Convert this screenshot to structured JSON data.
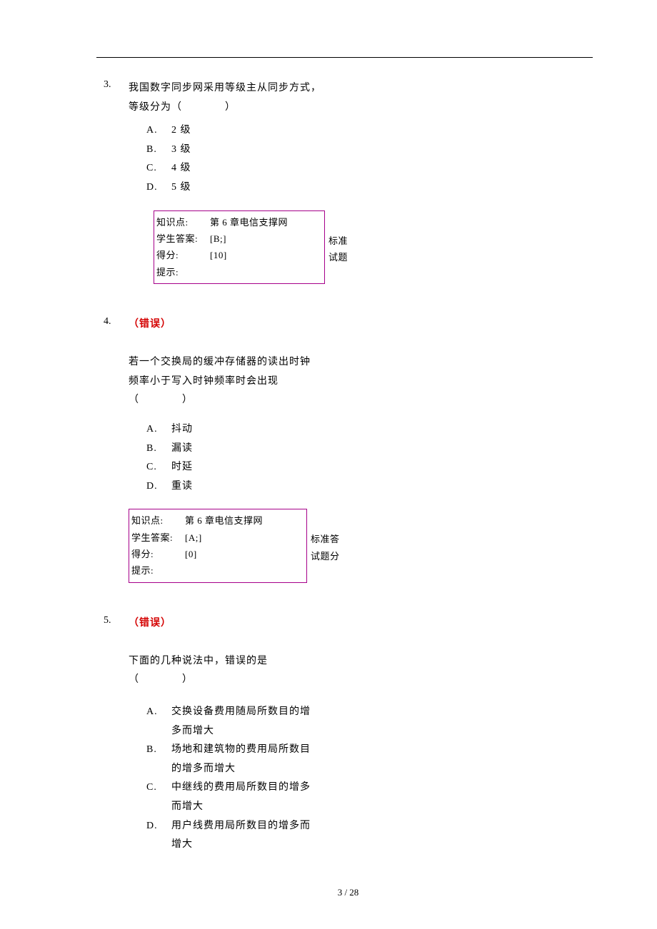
{
  "footer": "3 / 28",
  "questions": [
    {
      "num": "3.",
      "status": "",
      "stem1": "我国数字同步网采用等级主从同步方式，",
      "stem2": "等级分为（　　　　）",
      "options": [
        {
          "letter": "A.",
          "text": "2 级"
        },
        {
          "letter": "B.",
          "text": "3 级"
        },
        {
          "letter": "C.",
          "text": "4 级"
        },
        {
          "letter": "D.",
          "text": "5 级"
        }
      ],
      "info": {
        "knowledge_label": "知识点:",
        "knowledge_val": "第 6 章电信支撑网",
        "student_label": "学生答案:",
        "student_val": "[B;]",
        "score_label": "得分:",
        "score_val": "[10]",
        "hint_label": "提示:",
        "hint_val": "",
        "side1": "标准",
        "side2": "试题"
      }
    },
    {
      "num": "4.",
      "status": "（错误）",
      "stem1": "若一个交换局的缓冲存储器的读出时钟",
      "stem2": "频率小于写入时钟频率时会出现",
      "stem3": "（　　　　）",
      "options": [
        {
          "letter": "A.",
          "text": "抖动"
        },
        {
          "letter": "B.",
          "text": "漏读"
        },
        {
          "letter": "C.",
          "text": "时延"
        },
        {
          "letter": "D.",
          "text": "重读"
        }
      ],
      "info": {
        "knowledge_label": "知识点:",
        "knowledge_val": "第 6 章电信支撑网",
        "student_label": "学生答案:",
        "student_val": "[A;]",
        "score_label": "得分:",
        "score_val": "[0]",
        "hint_label": "提示:",
        "hint_val": "",
        "side1": "标准答",
        "side2": "试题分"
      }
    },
    {
      "num": "5.",
      "status": "（错误）",
      "stem1": "下面的几种说法中，错误的是",
      "stem2": "（　　　　）",
      "options": [
        {
          "letter": "A.",
          "text": "交换设备费用随局所数目的增多而增大"
        },
        {
          "letter": "B.",
          "text": "场地和建筑物的费用局所数目的增多而增大"
        },
        {
          "letter": "C.",
          "text": "中继线的费用局所数目的增多而增大"
        },
        {
          "letter": "D.",
          "text": "用户线费用局所数目的增多而增大"
        }
      ]
    }
  ]
}
